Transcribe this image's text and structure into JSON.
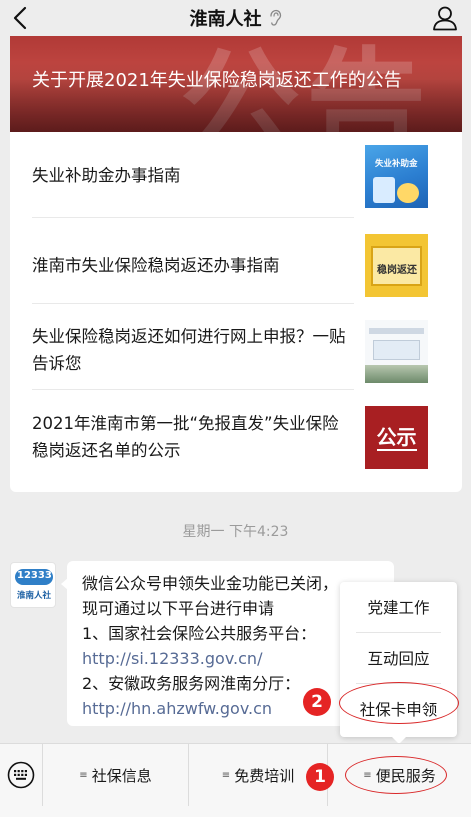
{
  "header": {
    "title": "淮南人社"
  },
  "banner": {
    "title": "关于开展2021年失业保险稳岗返还工作的公告",
    "bg_text": "公告"
  },
  "articles": [
    {
      "title": "失业补助金办事指南",
      "thumb_label": "失业补助金"
    },
    {
      "title": "淮南市失业保险稳岗返还办事指南",
      "thumb_label": "稳岗返还"
    },
    {
      "title": "失业保险稳岗返还如何进行网上申报？一贴告诉您",
      "thumb_label": ""
    },
    {
      "title": "2021年淮南市第一批“免报直发”失业保险稳岗返还名单的公示",
      "thumb_label": "公示"
    }
  ],
  "timestamp": "星期一 下午4:23",
  "avatar": {
    "num": "12333",
    "text": "淮南人社"
  },
  "message": {
    "lines": [
      "微信公众号申领失业金功能已关闭，",
      "现可通过以下平台进行申请",
      "1、国家社会保险公共服务平台：",
      "http://si.12333.gov.cn/",
      "2、安徽政务服务网淮南分厅：",
      "http://hn.ahzwfw.gov.cn"
    ]
  },
  "popup_menu": {
    "items": [
      "党建工作",
      "互动回应",
      "社保卡申领"
    ]
  },
  "annotations": {
    "one": "1",
    "two": "2"
  },
  "bottom_menu": {
    "items": [
      "社保信息",
      "免费培训",
      "便民服务"
    ]
  },
  "colors": {
    "link": "#576b95",
    "annotation": "#e52424",
    "background": "#ededed"
  }
}
